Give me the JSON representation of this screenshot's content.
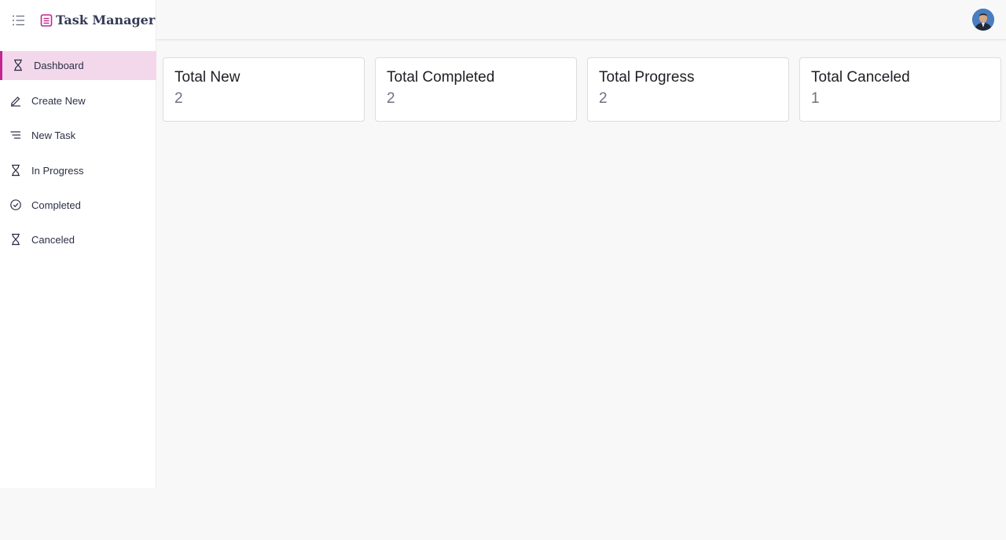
{
  "app": {
    "title": "Task Manager",
    "accent_color": "#c2278f",
    "active_bg": "#f3d8ec"
  },
  "header": {
    "menu_icon": "list-icon",
    "logo_icon": "notepad-icon",
    "avatar_icon": "user-avatar"
  },
  "sidebar": {
    "items": [
      {
        "label": "Dashboard",
        "icon": "hourglass-icon",
        "active": true
      },
      {
        "label": "Create New",
        "icon": "pencil-icon",
        "active": false
      },
      {
        "label": "New Task",
        "icon": "lines-icon",
        "active": false
      },
      {
        "label": "In Progress",
        "icon": "hourglass-icon",
        "active": false
      },
      {
        "label": "Completed",
        "icon": "check-circle-icon",
        "active": false
      },
      {
        "label": "Canceled",
        "icon": "hourglass-icon",
        "active": false
      }
    ]
  },
  "summary": {
    "cards": [
      {
        "title": "Total New",
        "count": "2"
      },
      {
        "title": "Total Completed",
        "count": "2"
      },
      {
        "title": "Total Progress",
        "count": "2"
      },
      {
        "title": "Total Canceled",
        "count": "1"
      }
    ]
  }
}
